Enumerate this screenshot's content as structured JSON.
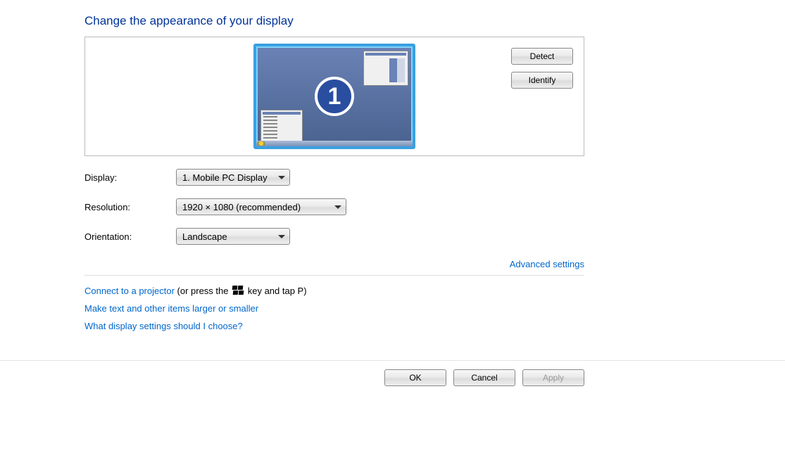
{
  "heading": "Change the appearance of your display",
  "monitor_number": "1",
  "buttons": {
    "detect": "Detect",
    "identify": "Identify",
    "ok": "OK",
    "cancel": "Cancel",
    "apply": "Apply"
  },
  "labels": {
    "display": "Display:",
    "resolution": "Resolution:",
    "orientation": "Orientation:"
  },
  "values": {
    "display": "1. Mobile PC Display",
    "resolution": "1920 × 1080 (recommended)",
    "orientation": "Landscape"
  },
  "links": {
    "advanced": "Advanced settings",
    "projector_link": "Connect to a projector",
    "projector_suffix1": " (or press the ",
    "projector_suffix2": " key and tap P)",
    "text_size": "Make text and other items larger or smaller",
    "help": "What display settings should I choose?"
  }
}
